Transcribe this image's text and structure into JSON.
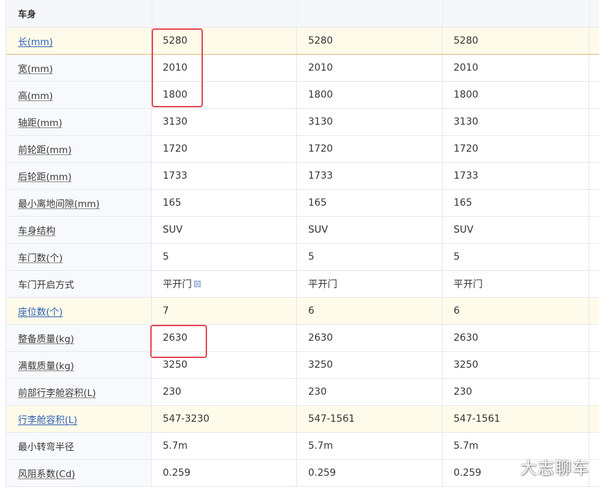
{
  "section": {
    "title": "车身"
  },
  "rows": [
    {
      "label": "长(mm)",
      "values": [
        "5280",
        "5280",
        "5280"
      ]
    },
    {
      "label": "宽(mm)",
      "values": [
        "2010",
        "2010",
        "2010"
      ]
    },
    {
      "label": "高(mm)",
      "values": [
        "1800",
        "1800",
        "1800"
      ]
    },
    {
      "label": "轴距(mm)",
      "values": [
        "3130",
        "3130",
        "3130"
      ]
    },
    {
      "label": "前轮距(mm)",
      "values": [
        "1720",
        "1720",
        "1720"
      ]
    },
    {
      "label": "后轮距(mm)",
      "values": [
        "1733",
        "1733",
        "1733"
      ]
    },
    {
      "label": "最小离地间隙(mm)",
      "values": [
        "165",
        "165",
        "165"
      ]
    },
    {
      "label": "车身结构",
      "values": [
        "SUV",
        "SUV",
        "SUV"
      ]
    },
    {
      "label": "车门数(个)",
      "values": [
        "5",
        "5",
        "5"
      ]
    },
    {
      "label": "车门开启方式",
      "values": [
        "平开门",
        "平开门",
        "平开门"
      ]
    },
    {
      "label": "座位数(个)",
      "values": [
        "7",
        "6",
        "6"
      ]
    },
    {
      "label": "整备质量(kg)",
      "values": [
        "2630",
        "2630",
        "2630"
      ]
    },
    {
      "label": "满载质量(kg)",
      "values": [
        "3250",
        "3250",
        "3250"
      ]
    },
    {
      "label": "前部行李舱容积(L)",
      "values": [
        "230",
        "230",
        "230"
      ]
    },
    {
      "label": "行李舱容积(L)",
      "values": [
        "547-3230",
        "547-1561",
        "547-1561"
      ]
    },
    {
      "label": "最小转弯半径",
      "values": [
        "5.7m",
        "5.7m",
        "5.7m"
      ]
    },
    {
      "label": "风阻系数(Cd)",
      "values": [
        "0.259",
        "0.259",
        "0.259"
      ]
    }
  ],
  "watermark": "大志聊车",
  "colors": {
    "highlight_row": "#fffbea",
    "link_blue": "#2b5fb5",
    "annotation_red": "#e5454f"
  }
}
